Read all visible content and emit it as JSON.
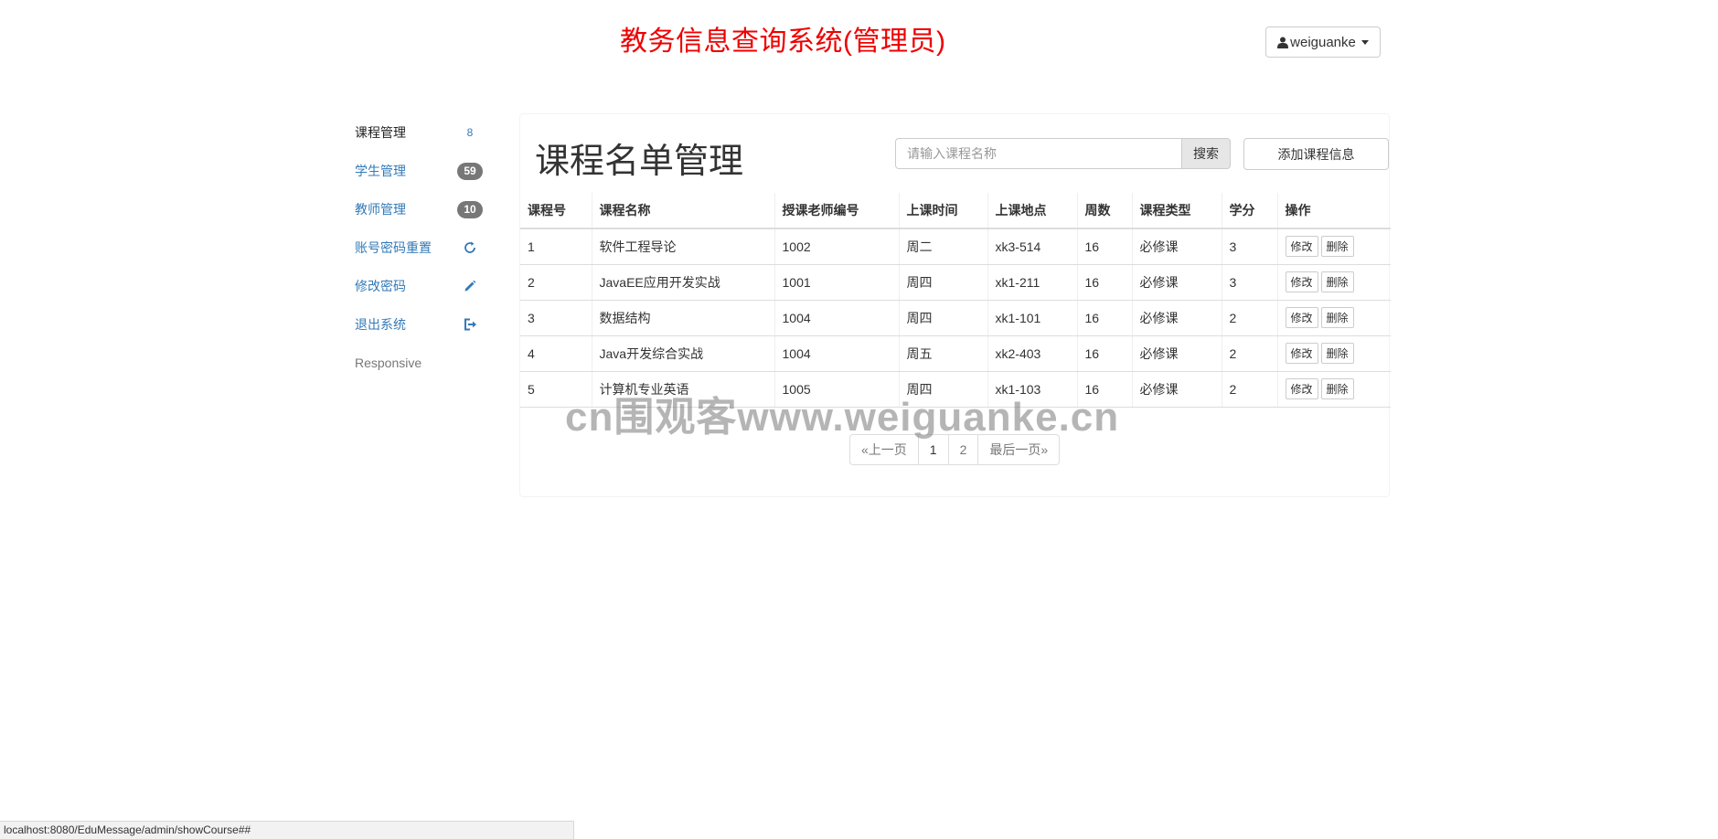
{
  "header": {
    "title": "教务信息查询系统(管理员)",
    "user_label": "weiguanke",
    "user_icon": "user-icon"
  },
  "sidebar": {
    "items": [
      {
        "label": "课程管理",
        "badge": "8",
        "active": true
      },
      {
        "label": "学生管理",
        "badge": "59"
      },
      {
        "label": "教师管理",
        "badge": "10"
      },
      {
        "label": "账号密码重置",
        "icon": "refresh-icon"
      },
      {
        "label": "修改密码",
        "icon": "pencil-icon"
      },
      {
        "label": "退出系统",
        "icon": "logout-icon"
      },
      {
        "label": "Responsive"
      }
    ]
  },
  "main": {
    "heading": "课程名单管理",
    "search_placeholder": "请输入课程名称",
    "search_button": "搜索",
    "add_button": "添加课程信息",
    "columns": [
      "课程号",
      "课程名称",
      "授课老师编号",
      "上课时间",
      "上课地点",
      "周数",
      "课程类型",
      "学分",
      "操作"
    ],
    "rows": [
      [
        "1",
        "软件工程导论",
        "1002",
        "周二",
        "xk3-514",
        "16",
        "必修课",
        "3"
      ],
      [
        "2",
        "JavaEE应用开发实战",
        "1001",
        "周四",
        "xk1-211",
        "16",
        "必修课",
        "3"
      ],
      [
        "3",
        "数据结构",
        "1004",
        "周四",
        "xk1-101",
        "16",
        "必修课",
        "2"
      ],
      [
        "4",
        "Java开发综合实战",
        "1004",
        "周五",
        "xk2-403",
        "16",
        "必修课",
        "2"
      ],
      [
        "5",
        "计算机专业英语",
        "1005",
        "周四",
        "xk1-103",
        "16",
        "必修课",
        "2"
      ]
    ],
    "edit_label": "修改",
    "delete_label": "删除"
  },
  "pagination": {
    "prev": "«上一页",
    "pages": [
      "1",
      "2"
    ],
    "current": "1",
    "last": "最后一页»"
  },
  "watermark": "cn围观客www.weiguanke.cn",
  "statusbar": "localhost:8080/EduMessage/admin/showCourse##"
}
